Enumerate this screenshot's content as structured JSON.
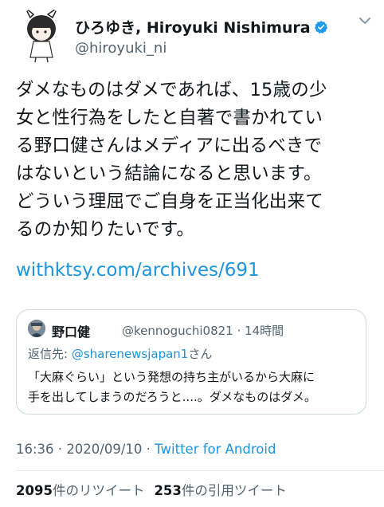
{
  "author": {
    "display_name": "ひろゆき, Hiroyuki Nishimura",
    "handle": "@hiroyuki_ni",
    "verified": true
  },
  "tweet": {
    "lines": [
      "ダメなものはダメであれば、15歳の少",
      "女と性行為をしたと自著で書かれてい",
      "る野口健さんはメディアに出るべきで",
      "はないという結論になると思います。",
      "どういう理屈でご自身を正当化出来て",
      "るのか知りたいです。"
    ],
    "link": "withktsy.com/archives/691"
  },
  "quoted_tweet": {
    "author_name": "野口健",
    "author_handle": "@kennoguchi0821",
    "time": "14時間",
    "reply_prefix": "返信先: ",
    "reply_to": "@sharenewsjapan1",
    "reply_suffix": "さん",
    "lines": [
      "「大麻ぐらい」という発想の持ち主がいるから大麻に",
      "手を出してしまうのだろうと....。ダメなものはダメ。"
    ]
  },
  "meta": {
    "time": "16:36",
    "date": "2020/09/10",
    "separator": " · ",
    "source": "Twitter for Android"
  },
  "stats": {
    "retweets_count": "2095",
    "retweets_label": "件のリツイート",
    "quotes_count": "253",
    "quotes_label": "件の引用ツイート"
  },
  "colors": {
    "link": "#1b95e0",
    "verified_badge": "#1d9bf0",
    "secondary_text": "#536471"
  },
  "icons": {
    "verified": "verified-badge-icon",
    "more": "chevron-down-icon"
  }
}
